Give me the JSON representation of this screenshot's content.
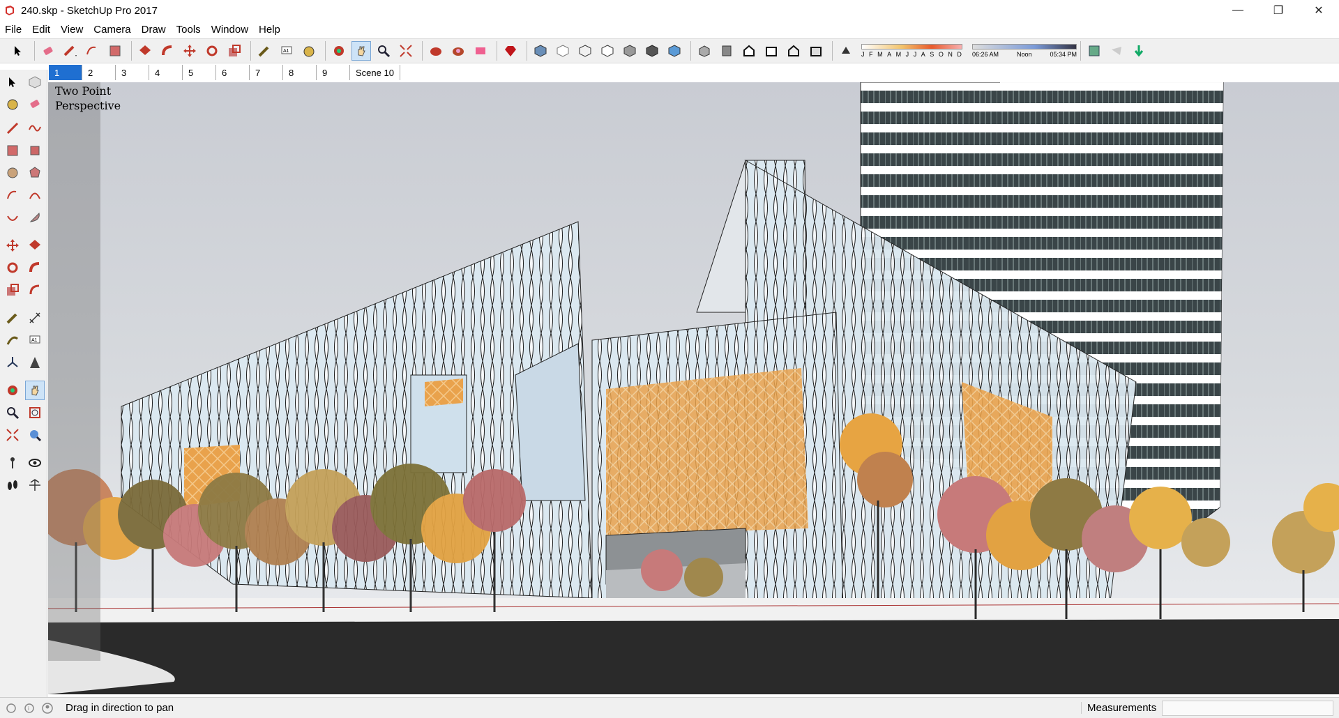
{
  "window": {
    "title": "240.skp - SketchUp Pro 2017",
    "minimize": "—",
    "restore": "❐",
    "close": "✕"
  },
  "menu": [
    "File",
    "Edit",
    "View",
    "Camera",
    "Draw",
    "Tools",
    "Window",
    "Help"
  ],
  "shadow_settings": {
    "months": [
      "J",
      "F",
      "M",
      "A",
      "M",
      "J",
      "J",
      "A",
      "S",
      "O",
      "N",
      "D"
    ],
    "time_start": "06:26 AM",
    "time_mid": "Noon",
    "time_end": "05:34 PM"
  },
  "scenes": {
    "tabs": [
      "1",
      "2",
      "3",
      "4",
      "5",
      "6",
      "7",
      "8",
      "9",
      "Scene 10"
    ],
    "active": "1"
  },
  "viewport": {
    "camera_label": "Two Point Perspective"
  },
  "status": {
    "hint": "Drag in direction to pan",
    "measurements_label": "Measurements",
    "measurements_value": ""
  },
  "colors": {
    "accent": "#1f6fd1",
    "sky": "#d0d3d8",
    "facade": "#d8e6ee",
    "panel": "#e9a24c",
    "road": "#2a2a2a"
  }
}
